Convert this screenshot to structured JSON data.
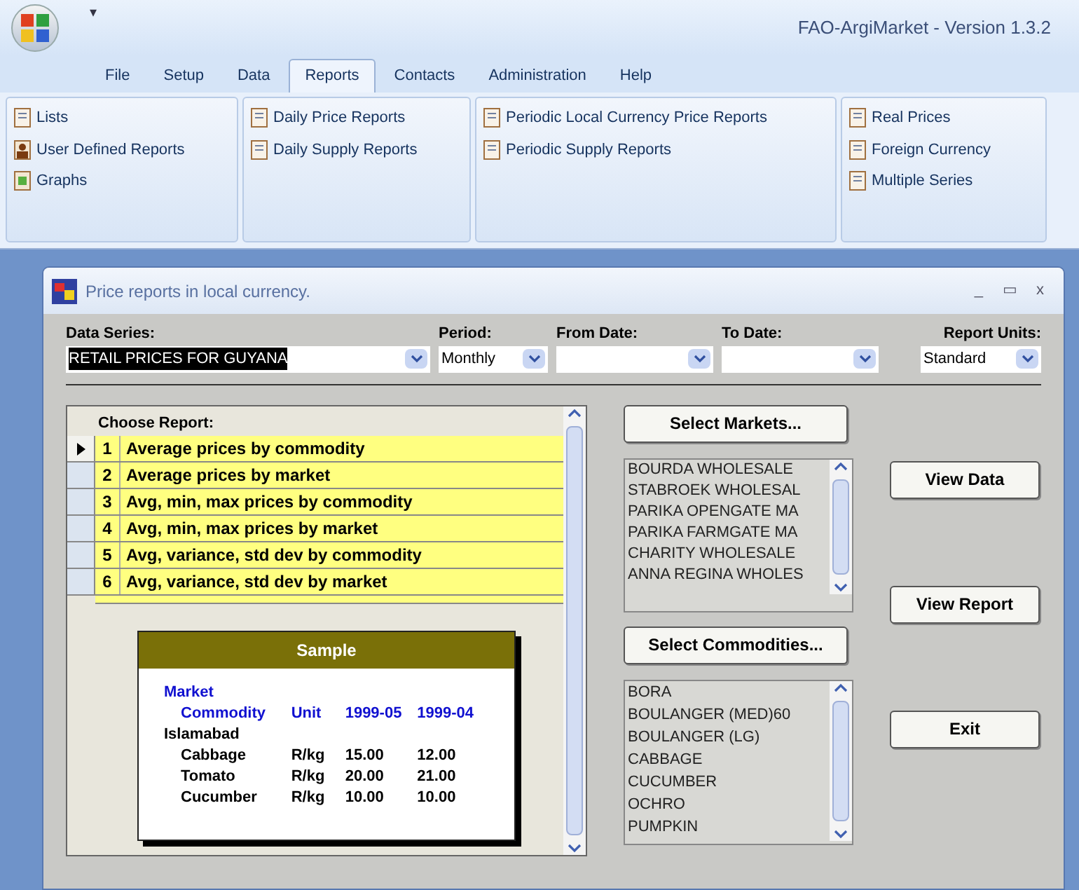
{
  "app": {
    "title": "FAO-ArgiMarket - Version 1.3.2",
    "quick_access": "▾"
  },
  "tabs": [
    {
      "label": "File",
      "selected": false
    },
    {
      "label": "Setup",
      "selected": false
    },
    {
      "label": "Data",
      "selected": false
    },
    {
      "label": "Reports",
      "selected": true
    },
    {
      "label": "Contacts",
      "selected": false
    },
    {
      "label": "Administration",
      "selected": false
    },
    {
      "label": "Help",
      "selected": false
    }
  ],
  "ribbon_groups": [
    {
      "items": [
        {
          "label": "Lists",
          "kind": "doc"
        },
        {
          "label": "User Defined Reports",
          "kind": "user"
        },
        {
          "label": "Graphs",
          "kind": "graph"
        }
      ]
    },
    {
      "items": [
        {
          "label": "Daily Price Reports",
          "kind": "doc"
        },
        {
          "label": "Daily Supply Reports",
          "kind": "doc"
        }
      ]
    },
    {
      "items": [
        {
          "label": "Periodic Local Currency Price Reports",
          "kind": "doc"
        },
        {
          "label": "Periodic Supply Reports",
          "kind": "doc"
        }
      ]
    },
    {
      "items": [
        {
          "label": "Real Prices",
          "kind": "doc"
        },
        {
          "label": "Foreign Currency",
          "kind": "doc"
        },
        {
          "label": "Multiple Series",
          "kind": "doc"
        }
      ]
    }
  ],
  "window": {
    "title": "Price reports in local currency.",
    "controls": [
      "_",
      "▭",
      "x"
    ]
  },
  "filters": [
    {
      "label": "Data Series:",
      "value": "RETAIL PRICES FOR GUYANA",
      "highlighted": true
    },
    {
      "label": "Period:",
      "value": "Monthly",
      "highlighted": false
    },
    {
      "label": "From Date:"
    },
    {
      "label": "To Date:"
    },
    {
      "label": "Report Units:",
      "value": "Standard",
      "highlighted": false
    }
  ],
  "report_list": {
    "heading": "Choose Report:",
    "rows": [
      {
        "number": "1",
        "name": "Average prices by commodity",
        "selected": true
      },
      {
        "number": "2",
        "name": "Average prices by market",
        "selected": false
      },
      {
        "number": "3",
        "name": "Avg, min, max prices by commodity",
        "selected": false
      },
      {
        "number": "4",
        "name": "Avg, min, max prices by market",
        "selected": false
      },
      {
        "number": "5",
        "name": "Avg, variance, std dev by commodity",
        "selected": false
      },
      {
        "number": "6",
        "name": "Avg, variance, std dev by market",
        "selected": false
      }
    ]
  },
  "sample": {
    "title": "Sample",
    "group_heading": "Market",
    "columns": [
      "Commodity",
      "Unit",
      "1999-05",
      "1999-04"
    ],
    "group": "Islamabad",
    "rows": [
      [
        "Cabbage",
        "R/kg",
        "15.00",
        "12.00"
      ],
      [
        "Tomato",
        "R/kg",
        "20.00",
        "21.00"
      ],
      [
        "Cucumber",
        "R/kg",
        "10.00",
        "10.00"
      ]
    ]
  },
  "markets": {
    "button": "Select Markets...",
    "items": [
      "BOURDA WHOLESALE",
      "STABROEK WHOLESAL",
      "PARIKA OPENGATE MA",
      "PARIKA FARMGATE MA",
      "CHARITY WHOLESALE",
      "ANNA REGINA WHOLES"
    ]
  },
  "commodities": {
    "button": "Select Commodities...",
    "items": [
      "BORA",
      "BOULANGER (MED)60",
      "BOULANGER (LG)",
      "CABBAGE",
      "CUCUMBER",
      "OCHRO",
      "PUMPKIN"
    ]
  },
  "actions": [
    "View Data",
    "View Report",
    "Exit"
  ]
}
